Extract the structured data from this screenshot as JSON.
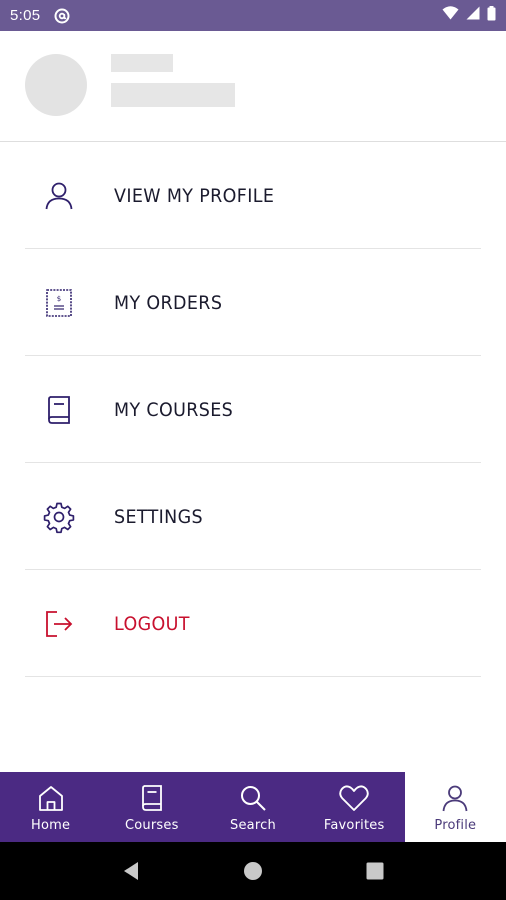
{
  "status_bar": {
    "time": "5:05",
    "icons": [
      "at-sign-icon",
      "wifi-icon",
      "signal-icon",
      "battery-icon"
    ]
  },
  "colors": {
    "status_bar": "#6a5a93",
    "bottom_nav": "#4b2a83",
    "icon_stroke": "#2e1f6b",
    "logout_red": "#c8102e",
    "text_dark": "#1b1b2e"
  },
  "menu": {
    "items": [
      {
        "label": "VIEW MY PROFILE",
        "icon": "user-icon"
      },
      {
        "label": "MY ORDERS",
        "icon": "receipt-icon"
      },
      {
        "label": "MY COURSES",
        "icon": "book-icon"
      },
      {
        "label": "SETTINGS",
        "icon": "gear-icon"
      },
      {
        "label": "LOGOUT",
        "icon": "logout-icon"
      }
    ]
  },
  "bottom_nav": {
    "items": [
      {
        "label": "Home",
        "icon": "home-icon"
      },
      {
        "label": "Courses",
        "icon": "book-icon"
      },
      {
        "label": "Search",
        "icon": "search-icon"
      },
      {
        "label": "Favorites",
        "icon": "heart-icon"
      },
      {
        "label": "Profile",
        "icon": "user-icon",
        "active": true
      }
    ]
  },
  "system_nav": {
    "buttons": [
      "back-icon",
      "home-circle-icon",
      "recents-icon"
    ]
  }
}
